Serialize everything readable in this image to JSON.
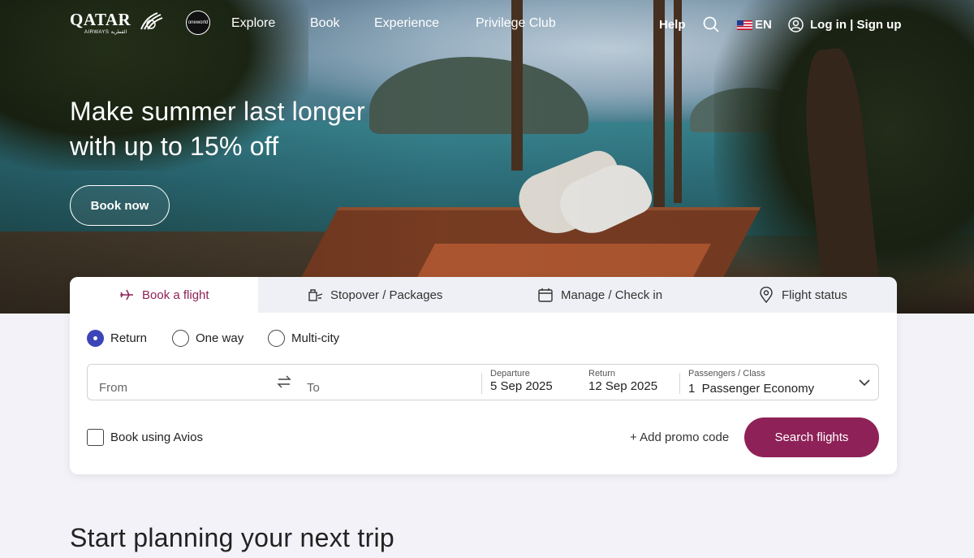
{
  "header": {
    "logo_text": "QATAR",
    "logo_sub": "AIRWAYS القطرية",
    "alliance_badge": "oneworld",
    "nav": [
      "Explore",
      "Book",
      "Experience",
      "Privilege Club"
    ],
    "help": "Help",
    "language": "EN",
    "login": "Log in | Sign up",
    "icons": [
      "search-icon",
      "us-flag-icon",
      "user-icon"
    ]
  },
  "hero": {
    "headline_line1": "Make summer last longer",
    "headline_line2": "with up to 15% off",
    "cta": "Book now"
  },
  "booking": {
    "tabs": [
      {
        "label": "Book a flight",
        "icon": "plane-icon",
        "active": true
      },
      {
        "label": "Stopover / Packages",
        "icon": "luggage-icon",
        "active": false
      },
      {
        "label": "Manage / Check in",
        "icon": "calendar-icon",
        "active": false
      },
      {
        "label": "Flight status",
        "icon": "location-pin-icon",
        "active": false
      }
    ],
    "trip_types": [
      {
        "label": "Return",
        "selected": true
      },
      {
        "label": "One way",
        "selected": false
      },
      {
        "label": "Multi-city",
        "selected": false
      }
    ],
    "from_placeholder": "From",
    "to_placeholder": "To",
    "departure_label": "Departure",
    "departure_value": "5 Sep 2025",
    "return_label": "Return",
    "return_value": "12 Sep 2025",
    "passengers_label": "Passengers / Class",
    "passengers_value": "1  Passenger Economy",
    "avios_label": "Book using Avios",
    "promo": "+ Add promo code",
    "search_button": "Search flights"
  },
  "section_title": "Start planning your next trip",
  "colors": {
    "brand": "#8e2157",
    "radio_selected": "#3c45b8",
    "page_bg": "#f2f2f8"
  }
}
